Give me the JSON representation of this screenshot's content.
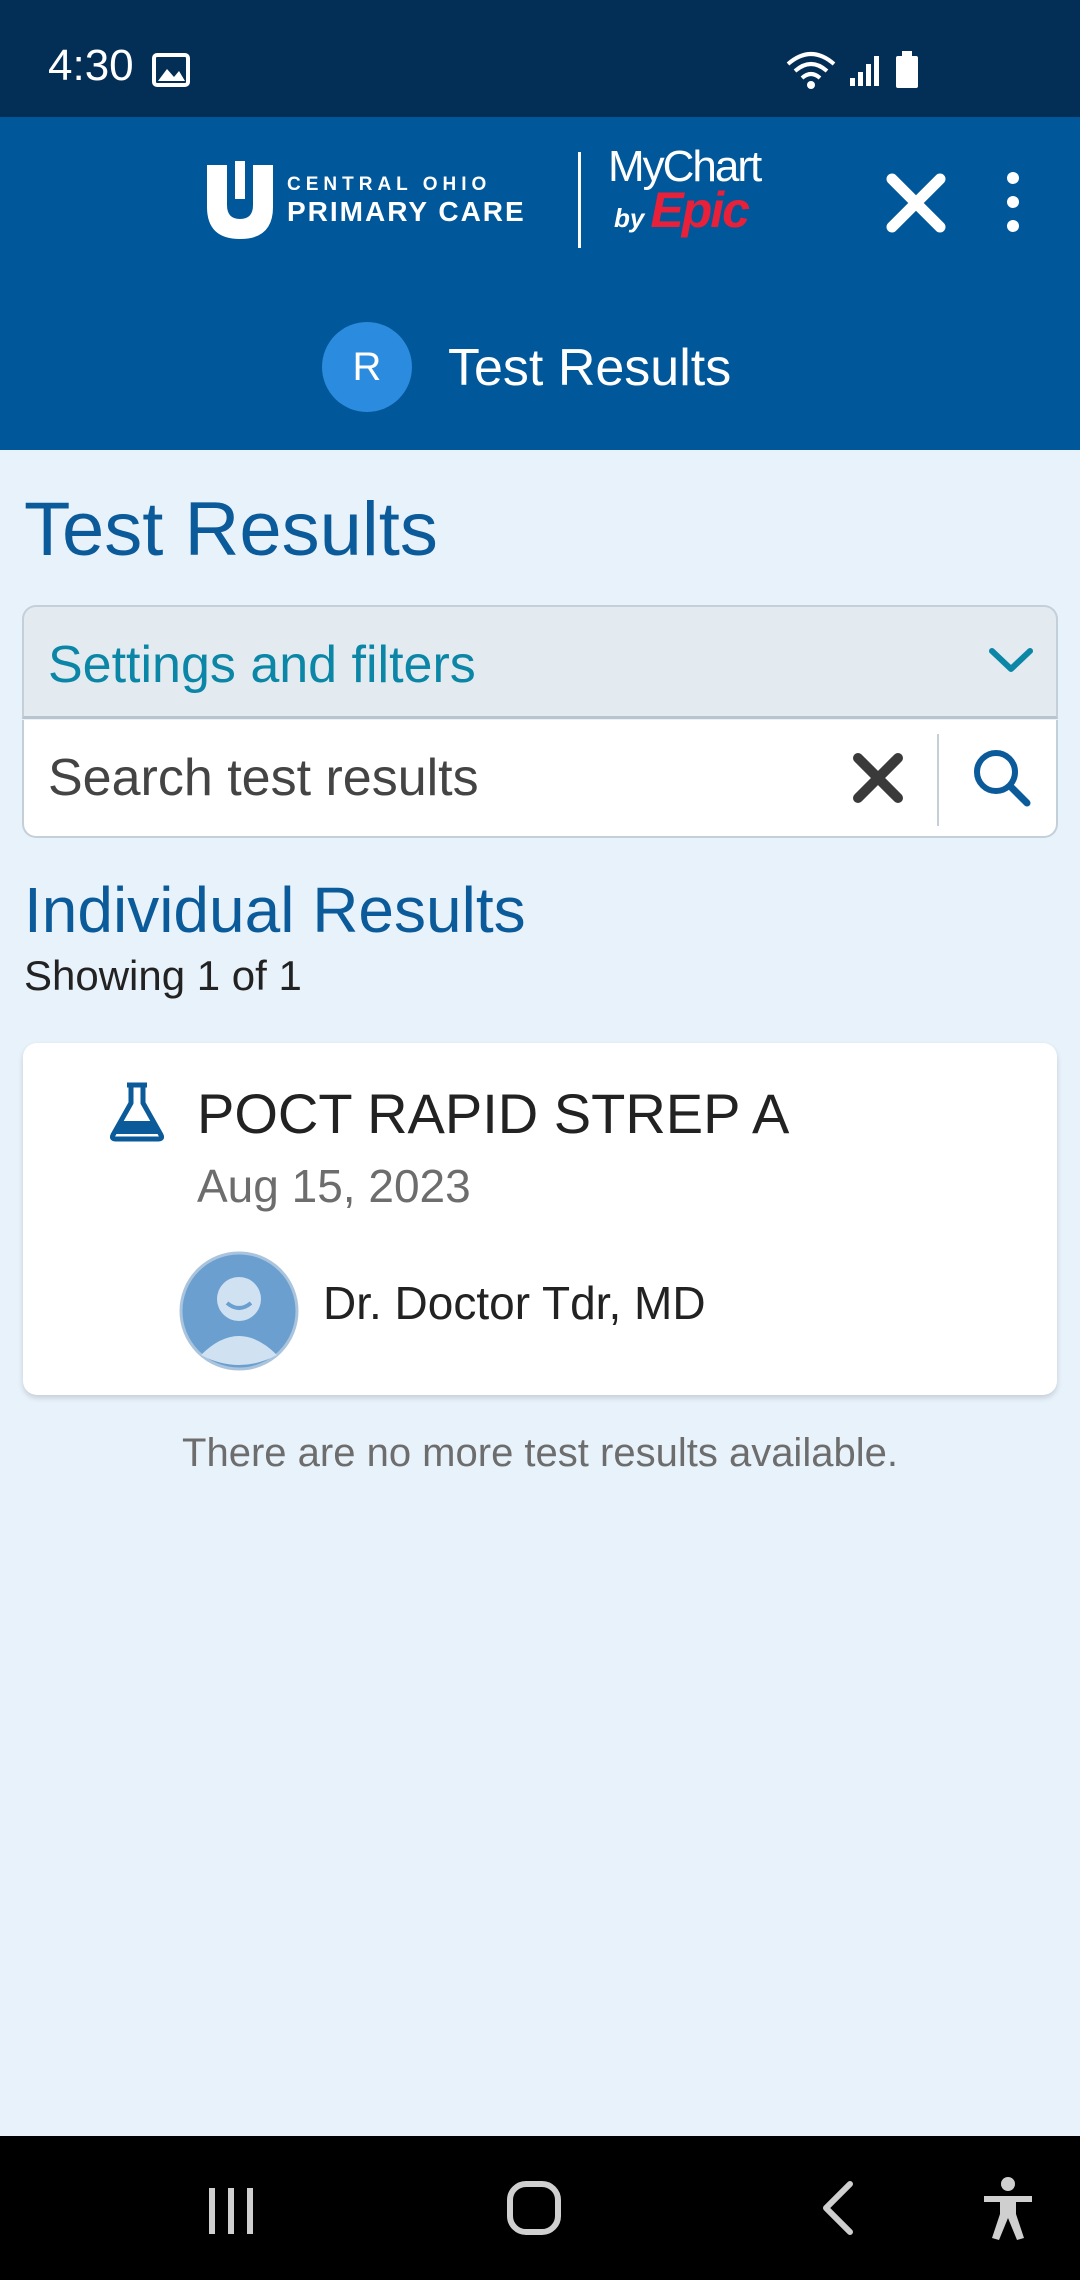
{
  "status_bar": {
    "time": "4:30",
    "icons": [
      "gallery-icon",
      "wifi-icon",
      "cell-signal-icon",
      "battery-icon"
    ]
  },
  "header": {
    "org_logo_small": "CENTRAL OHIO",
    "org_logo_big": "PRIMARY CARE",
    "app_logo_name": "MyChart",
    "app_logo_by": "by",
    "app_logo_epic": "Epic",
    "avatar_initial": "R",
    "title": "Test Results",
    "colors": {
      "background": "#00579a",
      "avatar": "#2b8bde",
      "epic_red": "#e8203a"
    }
  },
  "main": {
    "page_title": "Test Results",
    "filters_label": "Settings and filters",
    "search": {
      "placeholder": "Search test results",
      "value": ""
    },
    "section_title": "Individual Results",
    "section_count": "Showing 1 of 1",
    "results": [
      {
        "name": "POCT RAPID STREP A",
        "date": "Aug 15, 2023",
        "provider": "Dr. Doctor Tdr, MD",
        "icon": "flask-icon"
      }
    ],
    "no_more_text": "There are no more test results available.",
    "colors": {
      "title": "#0b5a9a",
      "accent": "#0b86a6",
      "background": "#e8f2fb"
    }
  },
  "nav_bar": {
    "icons": [
      "recents-icon",
      "home-icon",
      "back-icon",
      "accessibility-icon"
    ]
  }
}
